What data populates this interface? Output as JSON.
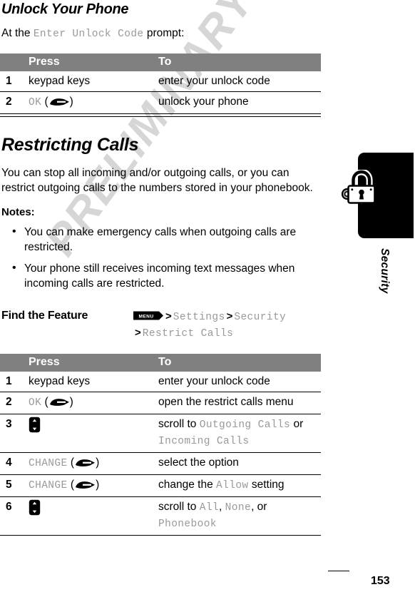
{
  "watermark": {
    "text": "PRELIMINARY"
  },
  "page": {
    "number": "153",
    "sidebar_label": "Security",
    "sidebar_icon": "padlock-key-icon"
  },
  "sections": [
    {
      "id": "unlock",
      "title": "Unlock Your Phone",
      "intro": {
        "before": "At the ",
        "mono": "Enter Unlock Code",
        "after": " prompt:"
      },
      "table": {
        "headers": {
          "num": "",
          "press": "Press",
          "to": "To"
        },
        "rows": [
          {
            "num": "1",
            "press": "keypad keys",
            "press_kind": "plain",
            "to": "enter your unlock code"
          },
          {
            "num": "2",
            "press": "OK",
            "press_kind": "softkey",
            "press_icon": "softkey-arrow-icon",
            "to": "unlock your phone"
          }
        ]
      }
    },
    {
      "id": "restrict",
      "title": "Restricting Calls",
      "body": "You can stop all incoming and/or outgoing calls, or you can restrict outgoing calls to the numbers stored in your phonebook.",
      "notes_label": "Notes:",
      "notes": [
        "You can make emergency calls when outgoing calls are restricted.",
        "Your phone still receives incoming text messages when incoming calls are restricted."
      ],
      "find_feature": {
        "label": "Find the Feature",
        "menu_key": "MENU",
        "menu_icon": "menu-key-icon",
        "separator": ">",
        "path": [
          "Settings",
          "Security",
          "Restrict Calls"
        ]
      },
      "table": {
        "headers": {
          "num": "",
          "press": "Press",
          "to": "To"
        },
        "rows": [
          {
            "num": "1",
            "press": "keypad keys",
            "press_kind": "plain",
            "to": "enter your unlock code"
          },
          {
            "num": "2",
            "press": "OK",
            "press_kind": "softkey",
            "press_icon": "softkey-arrow-icon",
            "to": "open the restrict calls menu"
          },
          {
            "num": "3",
            "press": "",
            "press_kind": "scrollkey",
            "press_icon": "scroll-up-down-key-icon",
            "to_prefix": "scroll to ",
            "to_mono_1": "Outgoing Calls",
            "to_mid": " or ",
            "to_mono_2": "Incoming Calls",
            "to_suffix": ""
          },
          {
            "num": "4",
            "press": "CHANGE",
            "press_kind": "softkey",
            "press_icon": "softkey-arrow-icon",
            "to": "select the option"
          },
          {
            "num": "5",
            "press": "CHANGE",
            "press_kind": "softkey",
            "press_icon": "softkey-arrow-icon",
            "to_prefix": "change the ",
            "to_mono_1": "Allow",
            "to_suffix": " setting"
          },
          {
            "num": "6",
            "press": "",
            "press_kind": "scrollkey",
            "press_icon": "scroll-up-down-key-icon",
            "to_prefix": "scroll to ",
            "to_mono_1": "All",
            "to_mid": ", ",
            "to_mono_2": "None",
            "to_mid_2": ", or ",
            "to_mono_3": "Phonebook"
          }
        ]
      }
    }
  ],
  "colors": {
    "table_header_bg": "#808080",
    "mono_text": "#999999",
    "watermark": "#d6d6d6",
    "rule": "#000000"
  }
}
